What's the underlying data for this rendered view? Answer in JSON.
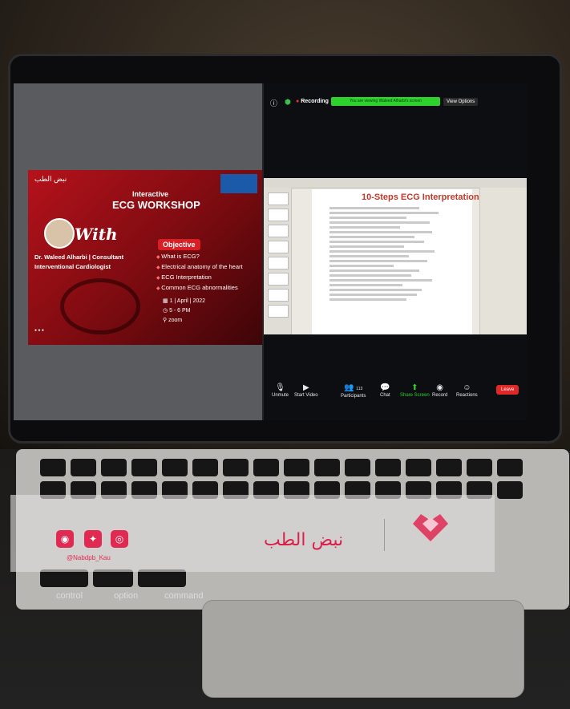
{
  "zoom": {
    "recording_label": "Recording",
    "viewing_banner": "You are viewing Waleed Alharbi's screen",
    "view_options": "View Options",
    "toolbar": [
      {
        "label": "Unmute",
        "icon": "mic-off-icon"
      },
      {
        "label": "Start Video",
        "icon": "video-off-icon"
      },
      {
        "label": "Participants",
        "icon": "participants-icon"
      },
      {
        "label": "Chat",
        "icon": "chat-icon"
      },
      {
        "label": "Share Screen",
        "icon": "share-screen-icon"
      },
      {
        "label": "Record",
        "icon": "record-icon"
      },
      {
        "label": "Reactions",
        "icon": "reactions-icon"
      }
    ],
    "leave": "Leave",
    "participants_count": "113"
  },
  "slide": {
    "interactive": "Interactive",
    "title": "ECG WORKSHOP",
    "with": "With",
    "speaker_name": "Dr. Waleed Alharbi | Consultant",
    "speaker_role": "Interventional Cardiologist",
    "objective": "Objective",
    "objectives": [
      "What is ECG?",
      "Electrical anatomy of the heart",
      "ECG Interpretation",
      "Common ECG abnormalities"
    ],
    "date": "1 | April | 2022",
    "time": "5 - 6 PM",
    "place": "zoom",
    "left_logo_text": "نبض الطب"
  },
  "document": {
    "title": "10-Steps ECG Interpretation"
  },
  "watermark": {
    "brand_arabic": "نبض الطب",
    "handle": "@Nabdpb_Kau",
    "colors": {
      "accent": "#e02a52"
    }
  },
  "keyboard": {
    "control": "control",
    "option": "option",
    "command": "command"
  }
}
